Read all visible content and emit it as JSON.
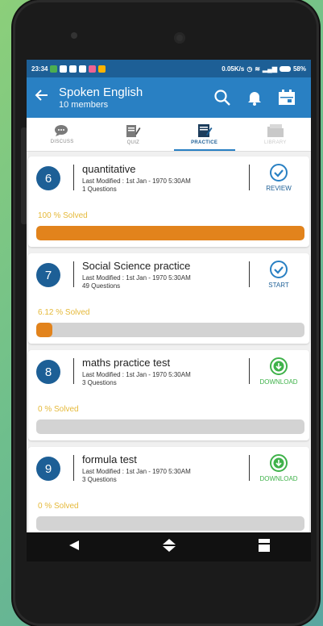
{
  "status_bar": {
    "time": "23:34",
    "speed": "0.05K/s",
    "battery": "58%"
  },
  "appbar": {
    "title": "Spoken English",
    "subtitle": "10 members"
  },
  "tabs": [
    {
      "label": "DISCUSS"
    },
    {
      "label": "QUIZ"
    },
    {
      "label": "PRACTICE"
    },
    {
      "label": "LIBRARY"
    }
  ],
  "cards": [
    {
      "number": "6",
      "name": "quantitative",
      "modified": "Last Modified : 1st Jan - 1970 5:30AM",
      "questions": "1 Questions",
      "action": "REVIEW",
      "solved": "100 % Solved",
      "progress": 100
    },
    {
      "number": "7",
      "name": "Social Science practice",
      "modified": "Last Modified : 1st Jan - 1970 5:30AM",
      "questions": "49 Questions",
      "action": "START",
      "solved": "6.12 % Solved",
      "progress": 6.12
    },
    {
      "number": "8",
      "name": "maths practice test",
      "modified": "Last Modified : 1st Jan - 1970 5:30AM",
      "questions": "3 Questions",
      "action": "DOWNLOAD",
      "solved": "0 % Solved",
      "progress": 0
    },
    {
      "number": "9",
      "name": "formula test",
      "modified": "Last Modified : 1st Jan - 1970 5:30AM",
      "questions": "3 Questions",
      "action": "DOWNLOAD",
      "solved": "0 % Solved",
      "progress": 0
    }
  ],
  "colors": {
    "primary": "#2980c3",
    "dark": "#1d5f96",
    "progress": "#e2831c",
    "download": "#3fb24a",
    "solved": "#e5b93a"
  }
}
